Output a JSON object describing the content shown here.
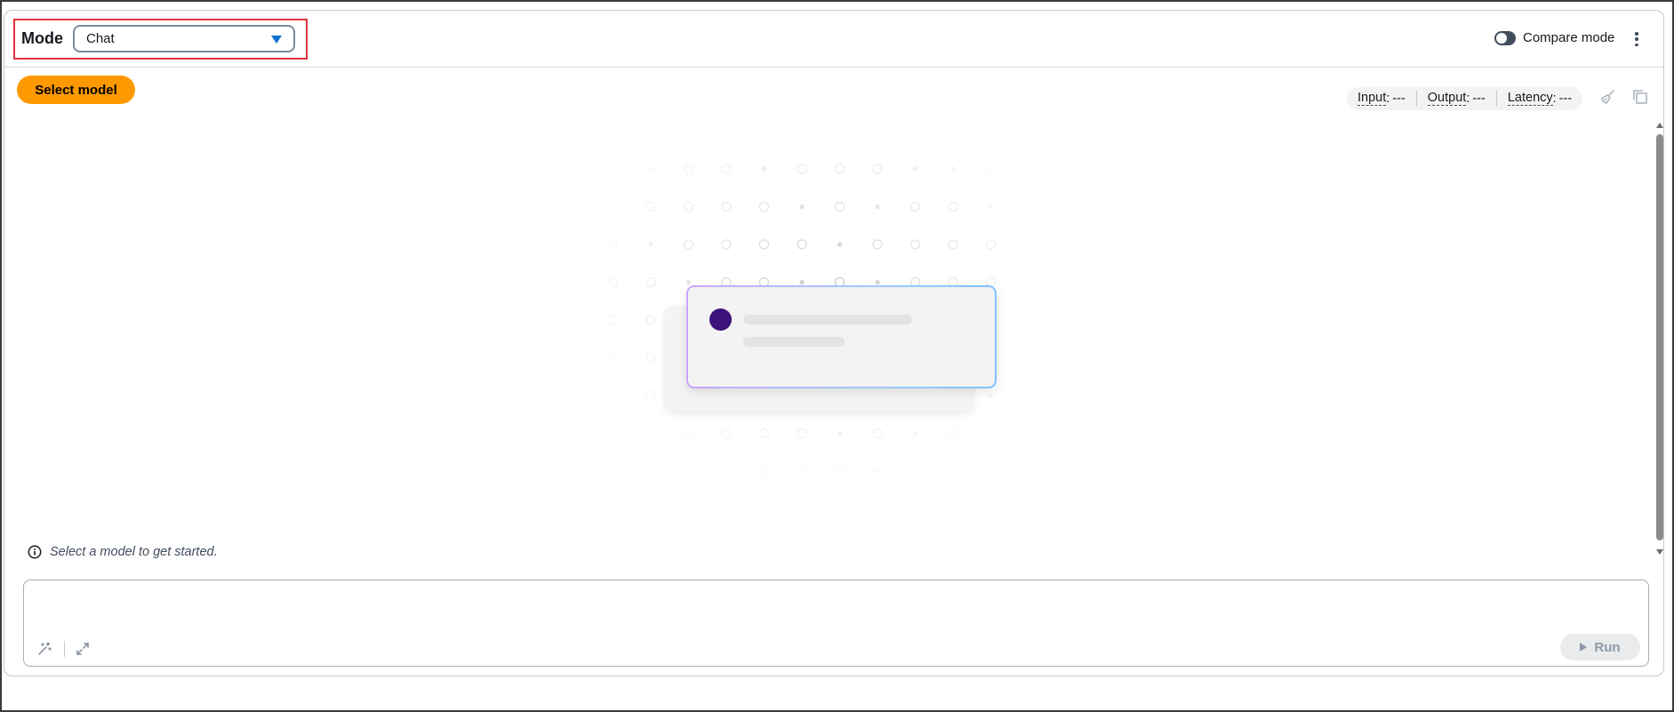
{
  "header": {
    "mode_label": "Mode",
    "mode_value": "Chat",
    "compare_mode_label": "Compare mode",
    "compare_mode_on": false
  },
  "toolbar": {
    "select_model_label": "Select model",
    "metrics": [
      {
        "key": "Input",
        "value": "---"
      },
      {
        "key": "Output",
        "value": "---"
      },
      {
        "key": "Latency",
        "value": "---"
      }
    ],
    "icons": [
      "clear-icon",
      "copy-icon"
    ]
  },
  "info": {
    "message": "Select a model to get started."
  },
  "prompt": {
    "value": "",
    "icons": [
      "magic-wand-icon",
      "expand-icon"
    ],
    "run_label": "Run"
  },
  "colors": {
    "accent": "#ff9900",
    "highlight": "#e0353b",
    "select_caret": "#0972d3",
    "avatar": "#3b1278"
  }
}
